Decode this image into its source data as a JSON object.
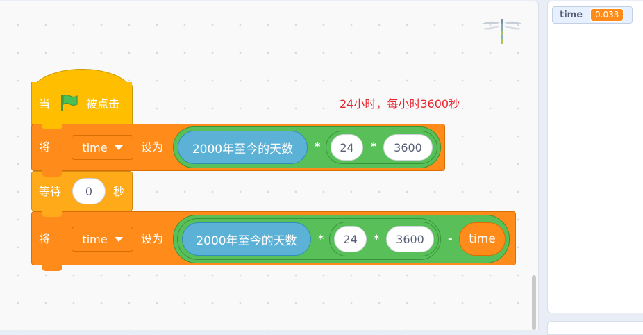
{
  "comment": "24小时，每小时3600秒",
  "monitor": {
    "name": "time",
    "value": "0.033"
  },
  "hat": {
    "prefix": "当",
    "suffix": "被点击",
    "flag_color": "#4cbf56"
  },
  "set1": {
    "label": "将",
    "var": "time",
    "to": "设为",
    "days": "2000年至今的天数",
    "op1": "*",
    "n1": "24",
    "op2": "*",
    "n2": "3600"
  },
  "wait": {
    "label": "等待",
    "value": "0",
    "unit": "秒"
  },
  "set2": {
    "label": "将",
    "var": "time",
    "to": "设为",
    "days": "2000年至今的天数",
    "op1": "*",
    "n1": "24",
    "op2": "*",
    "n2": "3600",
    "op3": "-",
    "var_reporter": "time"
  },
  "colors": {
    "events": "#ffbf00",
    "variables": "#ff8c1a",
    "control": "#ffab19",
    "operators": "#59c059",
    "sensing": "#5cb1d6"
  }
}
